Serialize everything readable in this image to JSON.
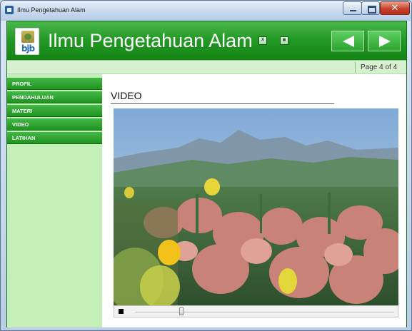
{
  "window": {
    "title": "Ilmu Pengetahuan Alam",
    "close_glyph": "✕"
  },
  "header": {
    "title": "Ilmu Pengetahuan Alam",
    "logo_text": "bjb",
    "small_buttons": [
      {
        "icon": "close-square-icon",
        "glyph": "x"
      },
      {
        "icon": "restore-square-icon",
        "glyph": "■"
      }
    ],
    "nav_prev_icon": "triangle-left-icon",
    "nav_next_icon": "triangle-right-icon"
  },
  "pagebar": {
    "page_label": "Page 4 of 4"
  },
  "sidebar": {
    "items": [
      {
        "label": "PROFIL"
      },
      {
        "label": "PENDAHULUAN"
      },
      {
        "label": "MATERI"
      },
      {
        "label": "VIDEO"
      },
      {
        "label": "LATIHAN"
      }
    ]
  },
  "content": {
    "section_title": "VIDEO"
  },
  "video_player": {
    "progress": 0.25,
    "stop_icon": "stop-icon"
  },
  "colors": {
    "app_green": "#1f8a22",
    "sidebar_bg": "#c4efb8",
    "menu_green": "#2fa631"
  }
}
